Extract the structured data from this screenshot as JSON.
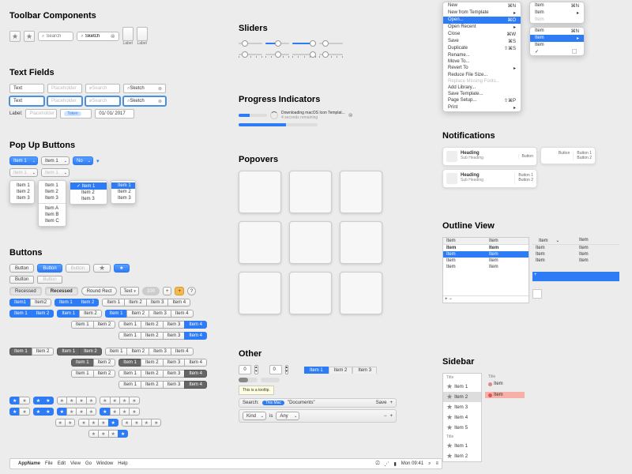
{
  "sections": {
    "toolbar": "Toolbar Components",
    "textfields": "Text Fields",
    "popups": "Pop Up Buttons",
    "buttons": "Buttons",
    "sliders": "Sliders",
    "progress": "Progress Indicators",
    "popovers": "Popovers",
    "other": "Other",
    "notifications": "Notifications",
    "outline": "Outline View",
    "sidebar": "Sidebar"
  },
  "toolbar": {
    "label": "Label",
    "search_ph": "Search",
    "sketch": "Sketch"
  },
  "textfields": {
    "text": "Text",
    "placeholder": "Placeholder",
    "search": "Search",
    "sketch": "Sketch",
    "label": "Label:",
    "token": "Token",
    "date": "01/ 01/ 2017"
  },
  "popup": {
    "item1": "Item 1",
    "item2": "Item 2",
    "item3": "Item 3",
    "itemA": "Item A",
    "itemB": "Item B",
    "itemC": "Item C",
    "no": "No"
  },
  "buttons": {
    "button": "Button",
    "recessed": "Recessed",
    "roundrect": "Round Rect",
    "text": "Text",
    "num": "100",
    "plus": "+",
    "help": "?",
    "item": "Item"
  },
  "progress": {
    "dl": "Downloading macOS Icon Templat...",
    "time": "4 seconds remaining"
  },
  "other": {
    "stepper_val": "0",
    "tooltip": "This is a tooltip.",
    "search_lbl": "Search:",
    "thismac": "This Mac",
    "docs": "\"Documents\"",
    "save": "Save",
    "kind": "Kind",
    "is": "is",
    "any": "Any"
  },
  "tabs": {
    "i1": "Item 1",
    "i2": "Item 2",
    "i3": "Item 3"
  },
  "ctx": {
    "new": "New",
    "new_sc": "⌘N",
    "newfrom": "New from Template",
    "open": "Open...",
    "open_sc": "⌘O",
    "openrecent": "Open Recent",
    "close": "Close",
    "close_sc": "⌘W",
    "save": "Save",
    "save_sc": "⌘S",
    "dup": "Duplicate",
    "dup_sc": "⇧⌘S",
    "rename": "Rename...",
    "moveto": "Move To...",
    "revert": "Revert To",
    "reduce": "Reduce File Size...",
    "replace": "Replace Missing Fonts...",
    "addlib": "Add Library...",
    "savetmpl": "Save Template...",
    "pagesetup": "Page Setup...",
    "pagesetup_sc": "⇧⌘P",
    "print": "Print",
    "item": "Item",
    "item_sc": "⌘N"
  },
  "notif": {
    "heading": "Heading",
    "sub": "Sub Heading",
    "button": "Button",
    "button1": "Button 1",
    "button2": "Button 2"
  },
  "outline": {
    "item": "Item"
  },
  "sidebar": {
    "title": "Title",
    "item": "Item"
  },
  "menubar": {
    "app": "AppName",
    "file": "File",
    "edit": "Edit",
    "view": "View",
    "go": "Go",
    "window": "Window",
    "help": "Help",
    "time": "Mon 09:41"
  }
}
